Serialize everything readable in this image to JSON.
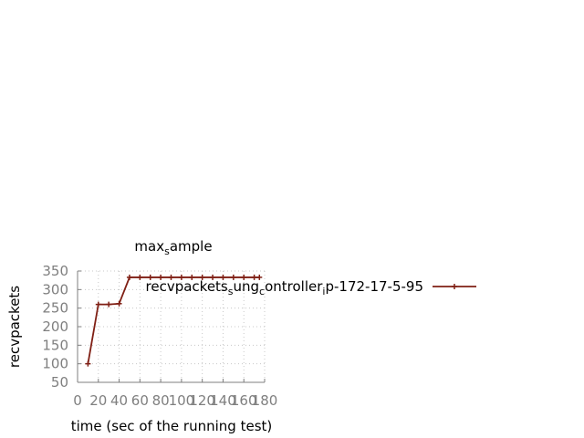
{
  "chart_data": {
    "type": "line",
    "title": "max_sample",
    "xlabel": "time (sec of the running test)",
    "ylabel": "recvpackets",
    "xlim": [
      0,
      180
    ],
    "ylim": [
      50,
      350
    ],
    "xticks": [
      0,
      20,
      40,
      60,
      80,
      100,
      120,
      140,
      160,
      180
    ],
    "yticks": [
      50,
      100,
      150,
      200,
      250,
      300,
      350
    ],
    "grid": true,
    "legend_position": "inside top-right",
    "series": [
      {
        "name": "recvpackets_sung_controller_ip-172-17-5-95",
        "color": "#7f1f14",
        "marker": "plus",
        "x": [
          10,
          20,
          30,
          40,
          50,
          60,
          70,
          80,
          90,
          100,
          110,
          120,
          130,
          140,
          150,
          160,
          170,
          175
        ],
        "y": [
          100,
          260,
          260,
          262,
          333,
          333,
          333,
          333,
          333,
          333,
          333,
          333,
          333,
          333,
          333,
          333,
          333,
          333
        ]
      }
    ]
  }
}
